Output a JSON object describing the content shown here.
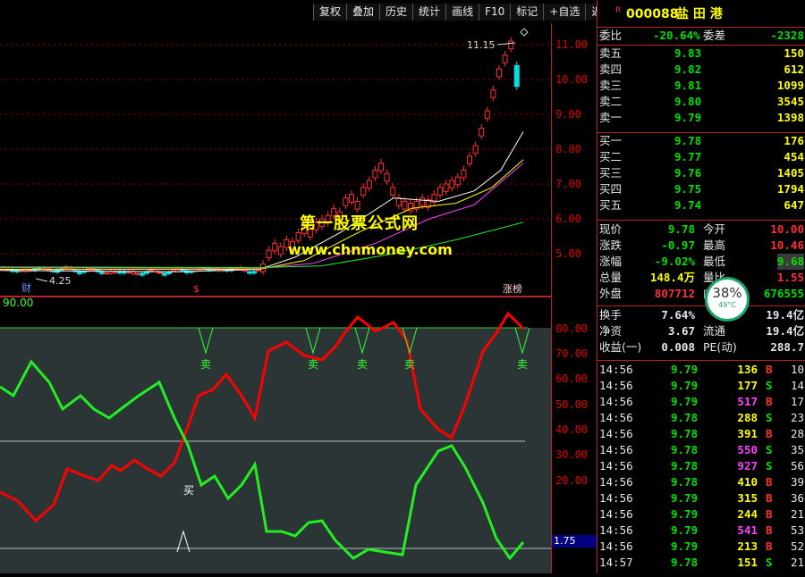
{
  "toolbar": [
    "复权",
    "叠加",
    "历史",
    "统计",
    "画线",
    "F10",
    "标记",
    "+自选",
    "返回"
  ],
  "stock": {
    "marker": "R",
    "code": "000088",
    "name": "盐 田 港"
  },
  "kline": {
    "price_ticks": [
      "11.00",
      "10.00",
      "9.00",
      "8.00",
      "7.00",
      "6.00",
      "5.00"
    ],
    "high_label": "11.15",
    "low_label": "4.25",
    "markers": {
      "cai": "财",
      "dollar": "$",
      "zhangbang": "涨榜"
    }
  },
  "osc": {
    "level_label": "90.00",
    "ticks": [
      "80.00",
      "70.00",
      "60.00",
      "50.00",
      "40.00",
      "30.00",
      "20.00"
    ],
    "current": "1.75",
    "buy": "买",
    "sell": "卖"
  },
  "colors": {
    "up": "#ff3030",
    "down": "#00e0e0",
    "red_line": "#ff0000",
    "green_line": "#22ee22"
  },
  "weibi": {
    "label": "委比",
    "value": "-20.64%",
    "diff_label": "委差",
    "diff": "-2328"
  },
  "asks": [
    {
      "label": "卖五",
      "price": "9.83",
      "vol": "150"
    },
    {
      "label": "卖四",
      "price": "9.82",
      "vol": "612"
    },
    {
      "label": "卖三",
      "price": "9.81",
      "vol": "1099"
    },
    {
      "label": "卖二",
      "price": "9.80",
      "vol": "3545"
    },
    {
      "label": "卖一",
      "price": "9.79",
      "vol": "1398"
    }
  ],
  "bids": [
    {
      "label": "买一",
      "price": "9.78",
      "vol": "176"
    },
    {
      "label": "买二",
      "price": "9.77",
      "vol": "454"
    },
    {
      "label": "买三",
      "price": "9.76",
      "vol": "1405"
    },
    {
      "label": "买四",
      "price": "9.75",
      "vol": "1794"
    },
    {
      "label": "买五",
      "price": "9.74",
      "vol": "647"
    }
  ],
  "stats": [
    {
      "l1": "现价",
      "v1": "9.78",
      "l2": "今开",
      "v2": "10.00"
    },
    {
      "l1": "涨跌",
      "v1": "-0.97",
      "l2": "最高",
      "v2": "10.46"
    },
    {
      "l1": "涨幅",
      "v1": "-9.02%",
      "l2": "最低",
      "v2": "9.68"
    },
    {
      "l1": "总量",
      "v1": "148.4万",
      "l2": "量比",
      "v2": "1.55"
    },
    {
      "l1": "外盘",
      "v1": "807712",
      "l2": "内盘",
      "v2": "676555"
    }
  ],
  "stats2": [
    {
      "l1": "换手",
      "v1": "7.64%",
      "l2": "",
      "v2": "19.4亿"
    },
    {
      "l1": "净资",
      "v1": "3.67",
      "l2": "流通",
      "v2": "19.4亿"
    },
    {
      "l1": "收益(一)",
      "v1": "0.008",
      "l2": "PE(动)",
      "v2": "288.7"
    }
  ],
  "temp": {
    "pct": "38%",
    "deg": "49°C"
  },
  "trades": [
    {
      "t": "14:56",
      "p": "9.79",
      "v": "136",
      "d": "B",
      "n": "10"
    },
    {
      "t": "14:56",
      "p": "9.79",
      "v": "177",
      "d": "S",
      "n": "14"
    },
    {
      "t": "14:56",
      "p": "9.79",
      "v": "517",
      "d": "B",
      "n": "17"
    },
    {
      "t": "14:56",
      "p": "9.78",
      "v": "288",
      "d": "S",
      "n": "23"
    },
    {
      "t": "14:56",
      "p": "9.78",
      "v": "391",
      "d": "B",
      "n": "28"
    },
    {
      "t": "14:56",
      "p": "9.78",
      "v": "550",
      "d": "S",
      "n": "35"
    },
    {
      "t": "14:56",
      "p": "9.78",
      "v": "927",
      "d": "S",
      "n": "56"
    },
    {
      "t": "14:56",
      "p": "9.78",
      "v": "410",
      "d": "B",
      "n": "39"
    },
    {
      "t": "14:56",
      "p": "9.79",
      "v": "315",
      "d": "B",
      "n": "36"
    },
    {
      "t": "14:56",
      "p": "9.79",
      "v": "244",
      "d": "B",
      "n": "21"
    },
    {
      "t": "14:56",
      "p": "9.79",
      "v": "541",
      "d": "B",
      "n": "53"
    },
    {
      "t": "14:56",
      "p": "9.79",
      "v": "213",
      "d": "B",
      "n": "52"
    },
    {
      "t": "14:57",
      "p": "9.78",
      "v": "151",
      "d": "S",
      "n": "21"
    }
  ],
  "watermark": {
    "line1": "第一股票公式网",
    "line2": "www.chnmoney.com"
  }
}
